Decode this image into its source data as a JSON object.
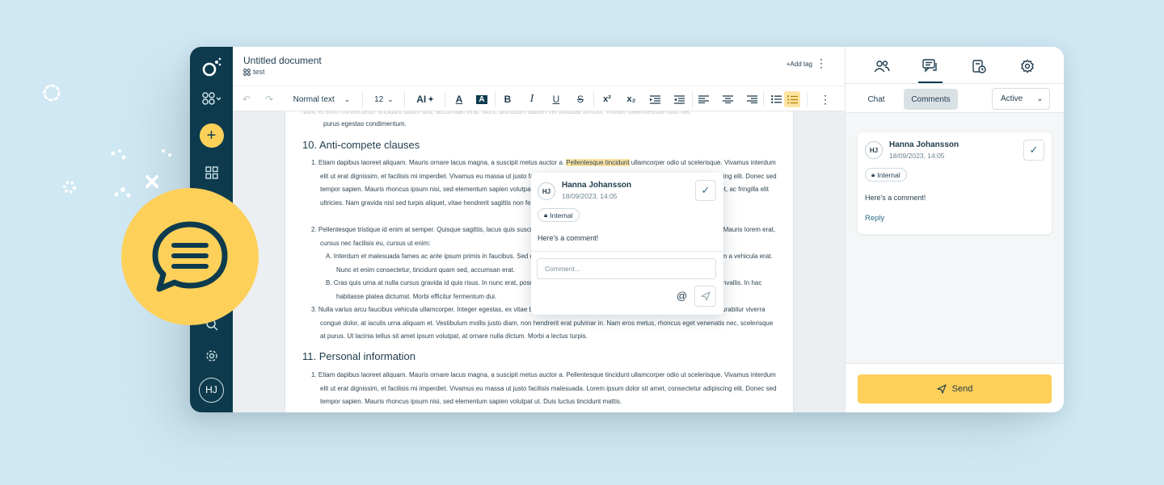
{
  "document": {
    "title": "Untitled document",
    "tag": "test",
    "add_tag_label": "+Add tag"
  },
  "toolbar": {
    "style_select": "Normal text",
    "font_size": "12",
    "ai_label": "AI",
    "superscript": "x²",
    "subscript": "x₂"
  },
  "content": {
    "top_line": "purus egestas condimentum.",
    "section10_heading": "10. Anti-compete clauses",
    "s10_item1": {
      "marker": "1.",
      "before": "Etiam dapibus laoreet aliquam. Mauris ornare lacus magna, a suscipit metus auctor a. ",
      "highlight": "Pellentesque tincidunt",
      "after": " ullamcorper odio ut scelerisque. Vivamus interdum elit ut erat dignissim, et facilisis mi imperdiet. Vivamus eu massa ut justo facilisis malesuada. Lorem ipsum dolor sit amet, consectetur adipiscing elit. Donec sed tempor sapien. Mauris rhoncus ipsum nisi, sed elementum sapien volutpat ut. Duis luctus tincidunt mattis. Phasellus porta enim ut nibh aliquet, ac fringilla elit ultricies. Nam gravida nisl sed turpis aliquet, vitae hendrerit sagittis non felis at porta."
    },
    "s10_item2": {
      "marker": "2.",
      "text": "Pellentesque tristique id enim at semper. Quisque sagittis, lacus quis suscipit faucibus, nibh metus aliquet libero, eget luctus tellus eget justo. Mauris lorem erat, cursus nec facilisis eu, cursus ut enim:"
    },
    "s10_sub_a": {
      "marker": "A.",
      "text": "Interdum et malesuada fames ac ante ipsum primis in faucibus. Sed dictum sem nec lorem tempor, vel bibendum nisi eleifend nibh. Etiam a vehicula erat. Nunc et enim consectetur, tincidunt quam sed, accumsan erat."
    },
    "s10_sub_b": {
      "marker": "B.",
      "text": "Cras quis urna at nulla cursus gravida id quis risus. In nunc erat, posuere id lacus in, imperdiet mollis sem. Nunc ullamcorper porttitor convallis. In hac habitasse platea dictumst. Morbi efficitur fermentum dui."
    },
    "s10_item3": {
      "marker": "3.",
      "text": "Nulla varius arcu faucibus vehicula ullamcorper. Integer egestas, ex vitae bibendum pretium, nibh quam pharetra ante, a lectus sed massa. Curabitur viverra congue dolor, at iaculis urna aliquam et. Vestibulum mollis justo diam, non hendrerit erat pulvinar in. Nam eros metus, rhoncus eget venenatis nec, scelerisque at purus. Ut lacinia tellus sit amet ipsum volutpat, at ornare nulla dictum. Morbi a lectus turpis."
    },
    "section11_heading": "11. Personal information",
    "s11_item1": {
      "marker": "1.",
      "text": "Etiam dapibus laoreet aliquam. Mauris ornare lacus magna, a suscipit metus auctor a. Pellentesque tincidunt ullamcorper odio ut scelerisque. Vivamus interdum elit ut erat dignissim, et facilisis mi imperdiet. Vivamus eu massa ut justo facilisis malesuada. Lorem ipsum dolor sit amet, consectetur adipiscing elit. Donec sed tempor sapien. Mauris rhoncus ipsum nisi, sed elementum sapien volutpat ut. Duis luctus tincidunt mattis."
    }
  },
  "popup_comment": {
    "initials": "HJ",
    "author": "Hanna Johansson",
    "date": "18/09/2023, 14:05",
    "badge": "Internal",
    "text": "Here's a comment!",
    "input_placeholder": "Comment...",
    "mention_symbol": "@"
  },
  "right_panel": {
    "tabs": [
      "Chat",
      "Comments"
    ],
    "status_select": "Active",
    "card": {
      "initials": "HJ",
      "author": "Hanna Johansson",
      "date": "18/09/2023, 14:05",
      "badge": "Internal",
      "text": "Here's a comment!",
      "reply_label": "Reply"
    },
    "send_label": "Send"
  },
  "rail": {
    "avatar_initials": "HJ"
  },
  "colors": {
    "background": "#cfe8f3",
    "rail": "#0d3b4d",
    "accent_yellow": "#fdd05a",
    "highlight": "#fde4a3",
    "text_dark": "#1f3b4d"
  }
}
